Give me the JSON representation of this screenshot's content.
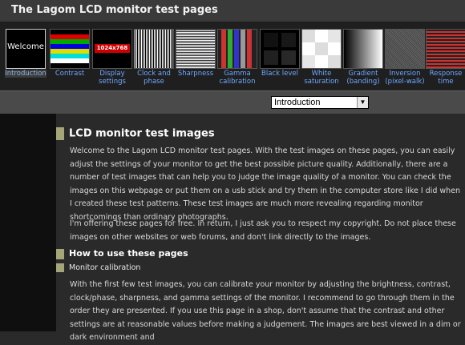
{
  "site": {
    "title": "The Lagom LCD monitor test pages"
  },
  "nav": {
    "items": [
      {
        "label": "Introduction",
        "thumb_text": "Welcome",
        "active": true
      },
      {
        "label": "Contrast"
      },
      {
        "label": "Display settings",
        "thumb_text": "1024x768"
      },
      {
        "label": "Clock and phase"
      },
      {
        "label": "Sharpness"
      },
      {
        "label": "Gamma calibration"
      },
      {
        "label": "Black level"
      },
      {
        "label": "White saturation"
      },
      {
        "label": "Gradient (banding)"
      },
      {
        "label": "Inversion (pixel-walk)"
      },
      {
        "label": "Response time"
      }
    ]
  },
  "selector": {
    "selected": "Introduction"
  },
  "content": {
    "heading": "LCD monitor test images",
    "paragraphs": [
      "Welcome to the Lagom LCD monitor test pages. With the test images on these pages, you can easily adjust the settings of your monitor to get the best possible picture quality. Additionally, there are a number of test images that can help you to judge the image quality of a monitor. You can check the images on this webpage or put them on a usb stick and try them in the computer store like I did when I created these test patterns. These test images are much more revealing regarding monitor shortcomings than ordinary photographs.",
      "I'm offering these pages for free. In return, I just ask you to respect my copyright. Do not place these images on other websites or web forums, and don't link directly to the images."
    ],
    "subheading": "How to use these pages",
    "subsubheading": "Monitor calibration",
    "paragraph3": "With the first few test images, you can calibrate your monitor by adjusting the brightness, contrast, clock/phase, sharpness, and gamma settings of the monitor. I recommend to go through them in the order they are presented. If you use this page in a shop, don't assume that the contrast and other settings are at reasonable values before making a judgement. The images are best viewed in a dim or dark environment and"
  },
  "colors": {
    "link": "#6ea8ff",
    "heading_marker": "#a5a57a",
    "background": "#2a2a2a"
  }
}
